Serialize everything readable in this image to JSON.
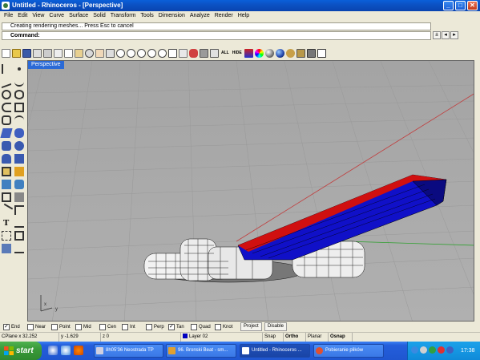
{
  "window": {
    "title": "Untitled - Rhinoceros - [Perspective]",
    "controls": {
      "minimize": "_",
      "maximize": "□",
      "close": "✕"
    }
  },
  "menu": [
    "File",
    "Edit",
    "View",
    "Curve",
    "Surface",
    "Solid",
    "Transform",
    "Tools",
    "Dimension",
    "Analyze",
    "Render",
    "Help"
  ],
  "command": {
    "history": "Creating rendering meshes... Press Esc to cancel",
    "prompt": "Command:",
    "buttons": [
      "±",
      "◂",
      "▸"
    ]
  },
  "toolbar": {
    "all_label": "ALL",
    "hide_label": "HIDE"
  },
  "viewport": {
    "name": "Perspective",
    "axis_x": "x",
    "axis_y": "y"
  },
  "osnap": {
    "items": [
      {
        "label": "End",
        "checked": true
      },
      {
        "label": "Near",
        "checked": false
      },
      {
        "label": "Point",
        "checked": false
      },
      {
        "label": "Mid",
        "checked": false
      },
      {
        "label": "Cen",
        "checked": false
      },
      {
        "label": "Int",
        "checked": false
      },
      {
        "label": "Perp",
        "checked": false
      },
      {
        "label": "Tan",
        "checked": true
      },
      {
        "label": "Quad",
        "checked": false
      },
      {
        "label": "Knot",
        "checked": false
      }
    ],
    "project": "Project",
    "disable": "Disable"
  },
  "status": {
    "cplane": "CPlane  x 32.252",
    "y": "y -1.629",
    "z": "z 0",
    "layer": "Layer 02",
    "snap": "Snap",
    "ortho": "Ortho",
    "planar": "Planar",
    "osnap": "Osnap"
  },
  "taskbar": {
    "start": "start",
    "tasks": [
      "8h05'36 Neostrada TP",
      "96. Bronski Beat - sm...",
      "Untitled - Rhinoceros ...",
      "Pobieranie plików"
    ],
    "clock": "17:38"
  },
  "colors": {
    "title_blue": "#0b52c4",
    "viewport_bg": "#a8a8a8",
    "model_blue": "#1010c8",
    "model_red": "#d01010",
    "layer_color": "#0000c0"
  }
}
